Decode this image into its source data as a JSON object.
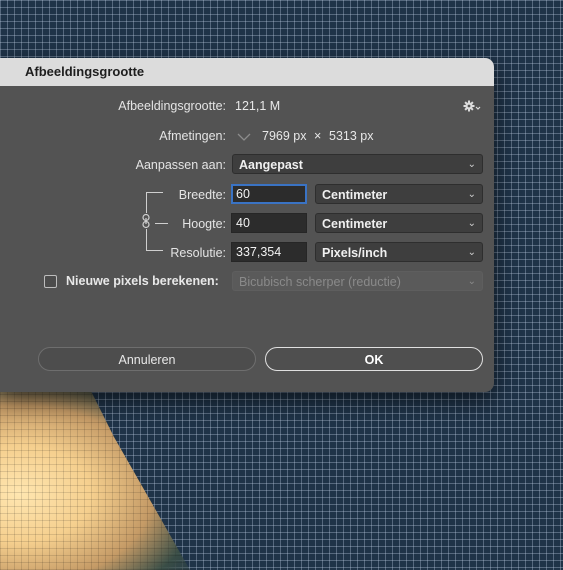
{
  "dialog": {
    "title": "Afbeeldingsgrootte",
    "image_size": {
      "label": "Afbeeldingsgrootte:",
      "value": "121,1 M"
    },
    "dimensions": {
      "label": "Afmetingen:",
      "width": "7969 px",
      "times": "×",
      "height": "5313 px"
    },
    "fit_to": {
      "label": "Aanpassen aan:",
      "value": "Aangepast"
    },
    "width": {
      "label": "Breedte:",
      "value": "60",
      "unit": "Centimeter"
    },
    "height": {
      "label": "Hoogte:",
      "value": "40",
      "unit": "Centimeter"
    },
    "resolution": {
      "label": "Resolutie:",
      "value": "337,354",
      "unit": "Pixels/inch"
    },
    "resample": {
      "label": "Nieuwe pixels berekenen:",
      "checked": false,
      "method": "Bicubisch scherper (reductie)"
    },
    "buttons": {
      "cancel": "Annuleren",
      "ok": "OK"
    }
  },
  "icons": {
    "settings": "gear-icon",
    "dimensions_toggle": "chevron-down-icon",
    "select_arrow": "chevron-down-icon",
    "link": "chain-link-icon"
  },
  "colors": {
    "dialog_bg": "#535353",
    "titlebar_bg": "#dcdcdc",
    "focus_ring": "#3a73c4",
    "input_bg": "#2c2c2c"
  }
}
